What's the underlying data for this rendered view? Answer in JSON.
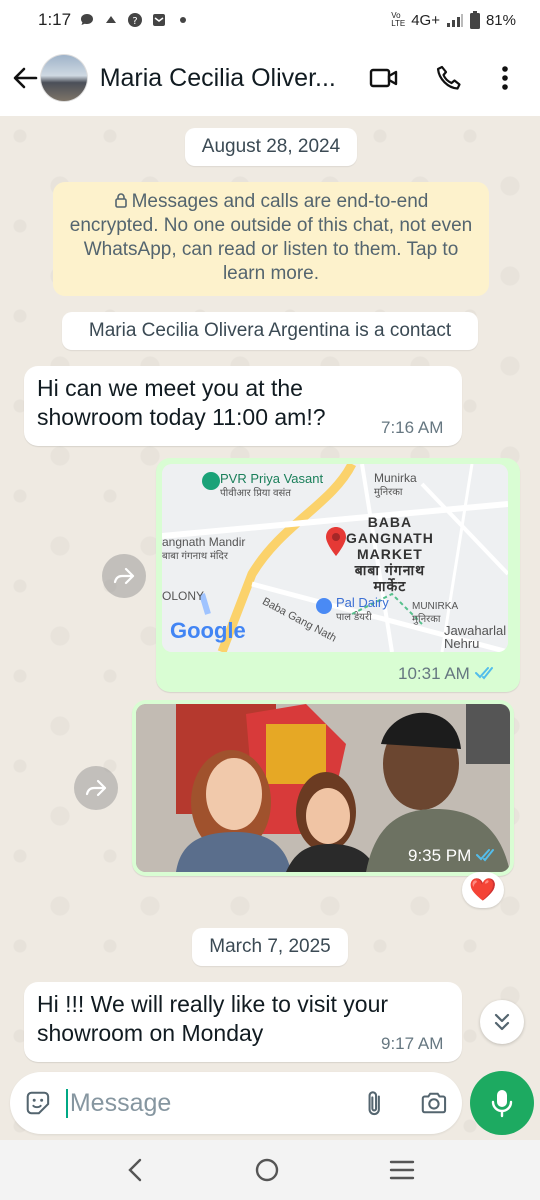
{
  "status_bar": {
    "time": "1:17",
    "network": "4G+",
    "volte": "Vo LTE",
    "battery": "81%"
  },
  "header": {
    "contact_name": "Maria Cecilia Oliver...",
    "icons": [
      "back-arrow-icon",
      "video-call-icon",
      "voice-call-icon",
      "more-options-icon"
    ]
  },
  "chat": {
    "date_1": "August 28, 2024",
    "encryption_notice": "Messages and calls are end-to-end encrypted. No one outside of this chat, not even WhatsApp, can read or listen to them. Tap to learn more.",
    "contact_notice": "Maria Cecilia Olivera Argentina is a contact",
    "messages": [
      {
        "direction": "in",
        "text": "Hi can we meet you at the showroom today 11:00 am!?",
        "time": "7:16 AM"
      },
      {
        "direction": "out",
        "type": "location",
        "time": "10:31 AM",
        "status": "read"
      },
      {
        "direction": "out",
        "type": "photo",
        "time": "9:35 PM",
        "status": "read",
        "reaction": "❤️"
      },
      {
        "direction": "in",
        "text": "Hi !!! We will really like to visit your showroom on Monday",
        "time": "9:17 AM"
      }
    ],
    "date_2": "March 7, 2025"
  },
  "map": {
    "labels": {
      "pvr": "PVR Priya Vasant",
      "pvr_hi": "पीवीआर प्रिया वसंत",
      "munirka": "Munirka",
      "munirka_hi": "मुनिरका",
      "baba_1": "BABA",
      "baba_2": "GANGNATH",
      "baba_3": "MARKET",
      "baba_hi_1": "बाबा गंगनाथ",
      "baba_hi_2": "मार्केट",
      "mandir": "angnath Mandir",
      "mandir_hi": "बाबा गंगनाथ मंदिर",
      "colony": "OLONY",
      "pal_dairy": "Pal Dairy",
      "pal_dairy_hi": "पाल डेयरी",
      "munirka_2": "MUNIRKA",
      "munirka_2_hi": "मुनिरका",
      "road": "Baba Gang Nath",
      "jnu_1": "Jawaharlal",
      "jnu_2": "Nehru",
      "logo": "Google"
    }
  },
  "composer": {
    "placeholder": "Message"
  },
  "colors": {
    "chat_bg": "#efeae2",
    "outgoing_bubble": "#d9fdd3",
    "accent": "#1daa61",
    "read_tick": "#53bdeb"
  }
}
